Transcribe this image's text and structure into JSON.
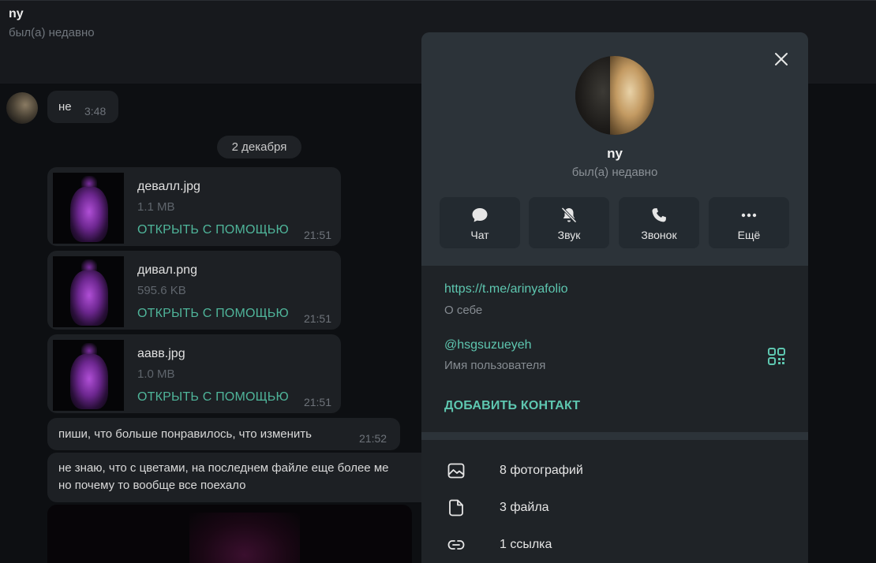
{
  "header": {
    "title": "ny",
    "status": "был(а) недавно"
  },
  "chat": {
    "first_message": {
      "text": "не",
      "time": "3:48"
    },
    "date_divider": "2 декабря",
    "files": [
      {
        "name": "девалл.jpg",
        "size": "1.1 MB",
        "action": "ОТКРЫТЬ С ПОМОЩЬЮ",
        "time": "21:51"
      },
      {
        "name": "дивал.png",
        "size": "595.6 KB",
        "action": "ОТКРЫТЬ С ПОМОЩЬЮ",
        "time": "21:51"
      },
      {
        "name": "аавв.jpg",
        "size": "1.0 MB",
        "action": "ОТКРЫТЬ С ПОМОЩЬЮ",
        "time": "21:51"
      }
    ],
    "message2": {
      "text": "пиши, что больше понравилось, что изменить",
      "time": "21:52"
    },
    "message3": {
      "line1": "не знаю, что с цветами, на последнем файле еще более ме",
      "line2": "но почему то вообще все поехало"
    }
  },
  "profile": {
    "name": "ny",
    "status": "был(а) недавно",
    "actions": [
      {
        "label": "Чат",
        "icon": "chat-icon"
      },
      {
        "label": "Звук",
        "icon": "bell-off-icon"
      },
      {
        "label": "Звонок",
        "icon": "phone-icon"
      },
      {
        "label": "Ещё",
        "icon": "more-icon"
      }
    ],
    "link": "https://t.me/arinyafolio",
    "link_caption": "О себе",
    "username": "@hsgsuzueyeh",
    "username_caption": "Имя пользователя",
    "add_contact": "ДОБАВИТЬ КОНТАКТ",
    "media": [
      {
        "label": "8 фотографий",
        "icon": "photo-icon"
      },
      {
        "label": "3 файла",
        "icon": "file-icon"
      },
      {
        "label": "1 ссылка",
        "icon": "link-icon"
      }
    ]
  },
  "colors": {
    "accent": "#5ec7b0",
    "panel": "#1f2327",
    "panel_top": "#2c3339",
    "chat_bg": "#0d0f12"
  }
}
